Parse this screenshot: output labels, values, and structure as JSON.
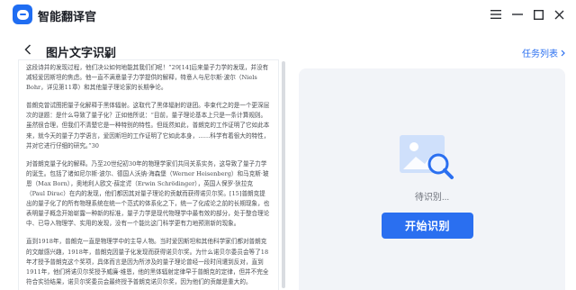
{
  "app": {
    "title": "智能翻译官"
  },
  "header": {
    "page_title": "图片文字识别",
    "task_list_label": "任务列表"
  },
  "document": {
    "paragraphs": [
      "这段诗并的发现过程，他们决公如何地能其我们们呢！”29[14]后来量子力学的发现，并没有减轻爱因斯坦的焦虑。他一直不满意量子力学提供的解释，特意人与尼尔斯·波尔（Niels Bohr，详见第11章）和其他量子理论家的长期争论。",
      "普朗克曾试图把量子化解释于黑体辐射。这取代了黑体辐射的谜团。非束代之的是一个更深层次的谜题：是什么导致了量子化？正如他所说：“目前，量子理论基本上只是一条计算规则。虽然很合理，但我们不清楚它是一种特别的特性。但既然如此，普朗克的工作证明了它如此本来，就今天的量子力学语言，爱因斯坦的工作证明了它如此本身，……科学有着很大的特性，并对它进行仔细的研究。”30",
      "对普朗克量子化的解释。乃至20世纪初30年的物理学家们共同关系实务，这导致了量子力学的诞生。包括了诸如尼尔斯·波尔、德国人沃纳·海森堡（Werner Heisenberg）和马克斯·玻恩（Max Born），奥地利人欧文·薛定谔（Erwin Schrödinger），英国人保罗·狄拉克（Paul Dirac）在内的发现，他们都因其对量子理论的贡献而获得诺贝尔奖。[15]普朗克提出的量子化了的所有物理系统在统一个范式的体系化之下，统一了化成论之前的长期现象，也表明量子概念开始崭露一种新的标准，量子力学是现代物理学中最有效的部分，处于整合理论中、已导入物理学、实用的发现，没有一个能比这门科学更有力地预测新的现象。",
      "直到1918年，普朗克一直是物理学中的主导人物。当时爱因斯坦和其他科学家们都对普朗克的文献感兴趣，1918年，普朗克因量子化发现而获得诺贝尔奖。为什么诺贝尔委员会等了18年才授予普朗克这个奖项，具体而言是因为所涉及的量子理论曾经一段时间遭到反对，直到1911年，他们将诺贝尔奖授予威廉·维恩，他的黑体辐射定律早于普朗克的定律，但并不完全符合实验结果，诺贝尔奖委员会最终授予普朗克诺贝尔奖，因为他们的贡献是重大的。"
    ]
  },
  "result": {
    "status_text": "待识别...",
    "start_button_label": "开始识别"
  },
  "colors": {
    "accent": "#2a6ff0",
    "panel_bg": "#f2f4f8"
  },
  "icons": [
    "app-logo-icon",
    "minimize-icon",
    "maximize-icon",
    "close-icon",
    "back-chevron-icon",
    "dropdown-caret-icon",
    "chevron-right-icon",
    "image-search-icon"
  ]
}
